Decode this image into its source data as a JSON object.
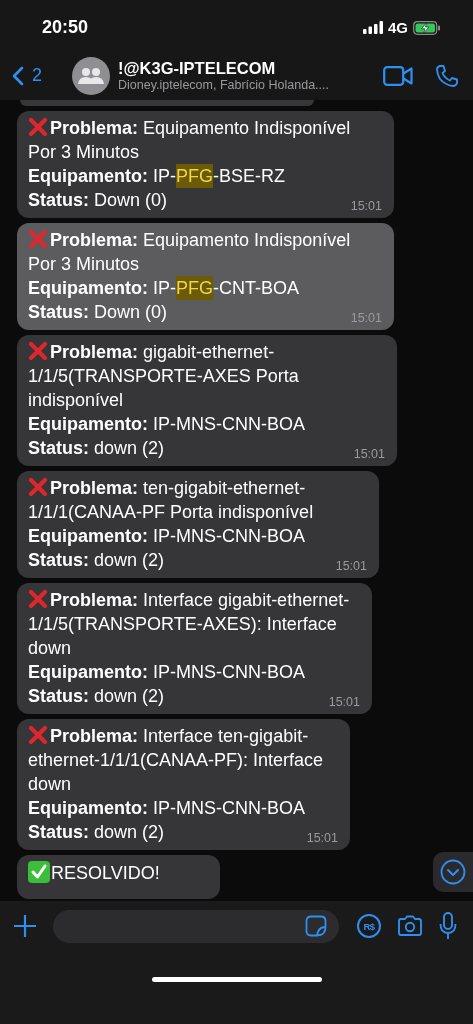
{
  "status_bar": {
    "time": "20:50",
    "network": "4G"
  },
  "header": {
    "back_count": "2",
    "title": "!@K3G-IPTELECOM",
    "subtitle": "Dioney.iptelecom, Fabrício Holanda...."
  },
  "messages": [
    {
      "kind": "problem",
      "selected": false,
      "time": "15:01",
      "fields": [
        {
          "label": "Problema:",
          "value": "Equipamento Indisponível Por 3 Minutos"
        },
        {
          "label": "Equipamento:",
          "value_parts": [
            {
              "text": "IP-",
              "match": false
            },
            {
              "text": "PFG",
              "match": true
            },
            {
              "text": "-BSE-RZ",
              "match": false
            }
          ]
        },
        {
          "label": "Status:",
          "value": "Down (0)"
        }
      ]
    },
    {
      "kind": "problem",
      "selected": true,
      "time": "15:01",
      "fields": [
        {
          "label": "Problema:",
          "value": "Equipamento Indisponível Por 3 Minutos"
        },
        {
          "label": "Equipamento:",
          "value_parts": [
            {
              "text": "IP-",
              "match": false
            },
            {
              "text": "PFG",
              "match": true
            },
            {
              "text": "-CNT-BOA",
              "match": false
            }
          ]
        },
        {
          "label": "Status:",
          "value": "Down (0)"
        }
      ]
    },
    {
      "kind": "problem",
      "selected": false,
      "time": "15:01",
      "fields": [
        {
          "label": "Problema:",
          "value": "gigabit-ethernet-1/1/5(TRANSPORTE-AXES Porta indisponível"
        },
        {
          "label": "Equipamento:",
          "value": "IP-MNS-CNN-BOA"
        },
        {
          "label": "Status:",
          "value": "down (2)"
        }
      ]
    },
    {
      "kind": "problem",
      "selected": false,
      "time": "15:01",
      "fields": [
        {
          "label": "Problema:",
          "value": "ten-gigabit-ethernet-1/1/1(CANAA-PF Porta indisponível"
        },
        {
          "label": "Equipamento:",
          "value": "IP-MNS-CNN-BOA"
        },
        {
          "label": "Status:",
          "value": "down (2)"
        }
      ]
    },
    {
      "kind": "problem",
      "selected": false,
      "time": "15:01",
      "fields": [
        {
          "label": "Problema:",
          "value": "Interface gigabit-ethernet-1/1/5(TRANSPORTE-AXES): Interface down"
        },
        {
          "label": "Equipamento:",
          "value": "IP-MNS-CNN-BOA"
        },
        {
          "label": "Status:",
          "value": "down (2)"
        }
      ]
    },
    {
      "kind": "problem",
      "selected": false,
      "time": "15:01",
      "fields": [
        {
          "label": "Problema:",
          "value": "Interface ten-gigabit-ethernet-1/1/1(CANAA-PF): Interface down"
        },
        {
          "label": "Equipamento:",
          "value": "IP-MNS-CNN-BOA"
        },
        {
          "label": "Status:",
          "value": "down (2)"
        }
      ]
    },
    {
      "kind": "resolved",
      "selected": false,
      "title": "RESOLVIDO!"
    }
  ],
  "composer": {
    "payment_label": "R$"
  }
}
